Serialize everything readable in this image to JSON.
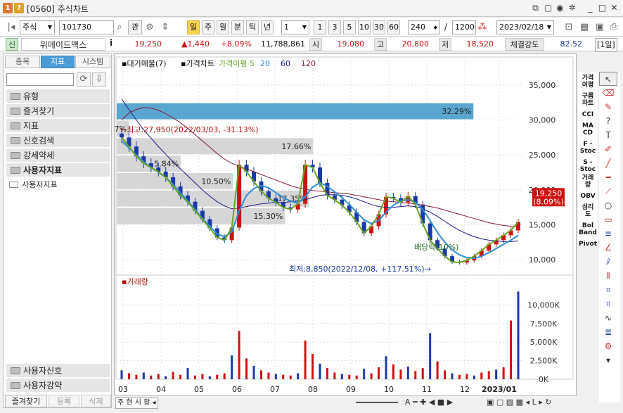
{
  "window": {
    "id": "[0560]",
    "title": "주식차트"
  },
  "toolbar": {
    "market": "주식",
    "code": "101730",
    "search_label": "관",
    "period_btns": [
      "일",
      "주",
      "월",
      "분",
      "틱",
      "년"
    ],
    "interval_value": "1",
    "num_btns": [
      "1",
      "3",
      "5",
      "10",
      "30",
      "60"
    ],
    "bars_value": "240",
    "slash": "/",
    "total_value": "1200",
    "date_value": "2023/02/18"
  },
  "quote": {
    "tag": "신",
    "name": "위메이드맥스",
    "info": "i",
    "price": "19,250",
    "change": "▲1,440",
    "change_pct": "+8.09%",
    "volume": "11,788,861",
    "open_label": "시",
    "open": "19,080",
    "high_label": "고",
    "high": "20,800",
    "low_label": "저",
    "low": "18,520",
    "strength_label": "체결강도",
    "strength": "82.52",
    "period_badge": "[1일]"
  },
  "left": {
    "tabs": [
      "종목",
      "지표",
      "시스템"
    ],
    "folders": [
      "유형",
      "즐겨찾기",
      "지표",
      "신호검색",
      "강세약세",
      "사용자지표"
    ],
    "subitem": "사용자지표",
    "bottom_folders": [
      "사용자신호",
      "사용자강약"
    ],
    "footer": [
      "즐겨찾기",
      "등록",
      "삭제"
    ]
  },
  "chart_data": [
    {
      "type": "line",
      "legend": [
        "대기매물(7)",
        "가격차트",
        "가격이평 5",
        "20",
        "60",
        "120"
      ],
      "legend_colors": [
        "#111",
        "#111",
        "#6aa321",
        "#2d8fd8",
        "#1a1a8a",
        "#8a1a3a"
      ],
      "yticks": [
        10000,
        15000,
        20000,
        25000,
        30000,
        35000
      ],
      "ylim": [
        8000,
        37000
      ],
      "current_price": "19,250",
      "current_pct": "(8.09%)",
      "annot_high": "←최고:27,950(2022/03/03, -31.13%)",
      "annot_low": "최저:8,850(2022/12/08, +117.51%)→",
      "annot_div": "배당락(10%)",
      "volume_profile": [
        {
          "low": 15000,
          "high": 17500,
          "pct": "15.30%",
          "frac": 0.42
        },
        {
          "low": 17500,
          "high": 20000,
          "pct": "17.35%",
          "frac": 0.48
        },
        {
          "low": 20000,
          "high": 22500,
          "pct": "10.50%",
          "frac": 0.29
        },
        {
          "low": 22500,
          "high": 25000,
          "pct": "5.84%",
          "frac": 0.16
        },
        {
          "low": 25000,
          "high": 27500,
          "pct": "17.66%",
          "frac": 0.49
        },
        {
          "low": 27500,
          "high": 30000,
          "pct": "1.07%",
          "frac": 0.03
        },
        {
          "low": 30000,
          "high": 32500,
          "pct": "32.29%",
          "frac": 0.89
        }
      ],
      "xlabels": [
        "03",
        "04",
        "05",
        "06",
        "07",
        "08",
        "09",
        "10",
        "11",
        "12",
        "2023/01"
      ],
      "close": [
        27500,
        26200,
        24800,
        23800,
        23200,
        22600,
        21800,
        20500,
        19200,
        18300,
        17000,
        15800,
        14500,
        13200,
        12800,
        14600,
        23600,
        22600,
        21200,
        19800,
        18800,
        18200,
        17500,
        17200,
        18000,
        23600,
        23200,
        21000,
        19200,
        18600,
        17800,
        16800,
        15400,
        13800,
        14800,
        16500,
        19000,
        18800,
        18200,
        19100,
        17900,
        15200,
        12800,
        11600,
        10500,
        9700,
        9600,
        9900,
        10500,
        11300,
        12200,
        12800,
        13500,
        14200,
        15400
      ],
      "ma20": [
        27000,
        26000,
        25000,
        24000,
        23200,
        22500,
        21800,
        20800,
        19600,
        18400,
        17200,
        15900,
        14800,
        13700,
        13300,
        14000,
        17000,
        19200,
        20200,
        20600,
        20300,
        19600,
        18900,
        18400,
        18100,
        19000,
        20400,
        21000,
        20500,
        19700,
        18900,
        17900,
        16800,
        15700,
        15200,
        15600,
        16800,
        17800,
        18400,
        18600,
        18200,
        17200,
        15600,
        13900,
        12500,
        11400,
        10700,
        10300,
        10200,
        10500,
        11000,
        11600,
        12200,
        12800,
        13500
      ],
      "ma60": [
        33000,
        31500,
        30000,
        28600,
        27400,
        26200,
        25100,
        24000,
        23000,
        22000,
        21000,
        20000,
        19100,
        18300,
        17700,
        17300,
        17400,
        17600,
        17800,
        18000,
        18100,
        18200,
        18200,
        18300,
        18400,
        18600,
        18900,
        19200,
        19300,
        19300,
        19200,
        19000,
        18700,
        18300,
        17900,
        17600,
        17500,
        17500,
        17600,
        17700,
        17600,
        17300,
        16800,
        16200,
        15500,
        14800,
        14200,
        13700,
        13300,
        13000,
        12800,
        12700,
        12600,
        12600,
        12700
      ],
      "ma120": [
        30000,
        31000,
        31500,
        31800,
        31700,
        31400,
        30900,
        30300,
        29600,
        28800,
        27900,
        27000,
        26100,
        25200,
        24400,
        23800,
        23400,
        23000,
        22600,
        22200,
        21800,
        21400,
        21000,
        20600,
        20300,
        20100,
        19900,
        19800,
        19700,
        19600,
        19500,
        19400,
        19200,
        19000,
        18800,
        18600,
        18400,
        18300,
        18200,
        18100,
        18000,
        17800,
        17600,
        17400,
        17100,
        16800,
        16500,
        16200,
        15900,
        15600,
        15300,
        15100,
        14900,
        14800,
        14700
      ]
    },
    {
      "type": "bar",
      "legend": [
        "거래량"
      ],
      "yticks_labels": [
        "0K",
        "2,500K",
        "5,000K",
        "7,500K",
        "10,000K"
      ],
      "ylim": [
        0,
        12500000
      ],
      "values": [
        1200000,
        800000,
        600000,
        900000,
        500000,
        700000,
        400000,
        1000000,
        600000,
        1500000,
        500000,
        700000,
        400000,
        600000,
        800000,
        3200000,
        6500000,
        2800000,
        1800000,
        1200000,
        900000,
        700000,
        600000,
        500000,
        800000,
        5200000,
        3400000,
        2100000,
        1500000,
        900000,
        700000,
        600000,
        500000,
        1400000,
        800000,
        1600000,
        3100000,
        2000000,
        1300000,
        1700000,
        1100000,
        1500000,
        6200000,
        2400000,
        1200000,
        800000,
        600000,
        700000,
        500000,
        900000,
        1100000,
        1300000,
        1600000,
        7900000,
        11800000
      ]
    }
  ]
}
